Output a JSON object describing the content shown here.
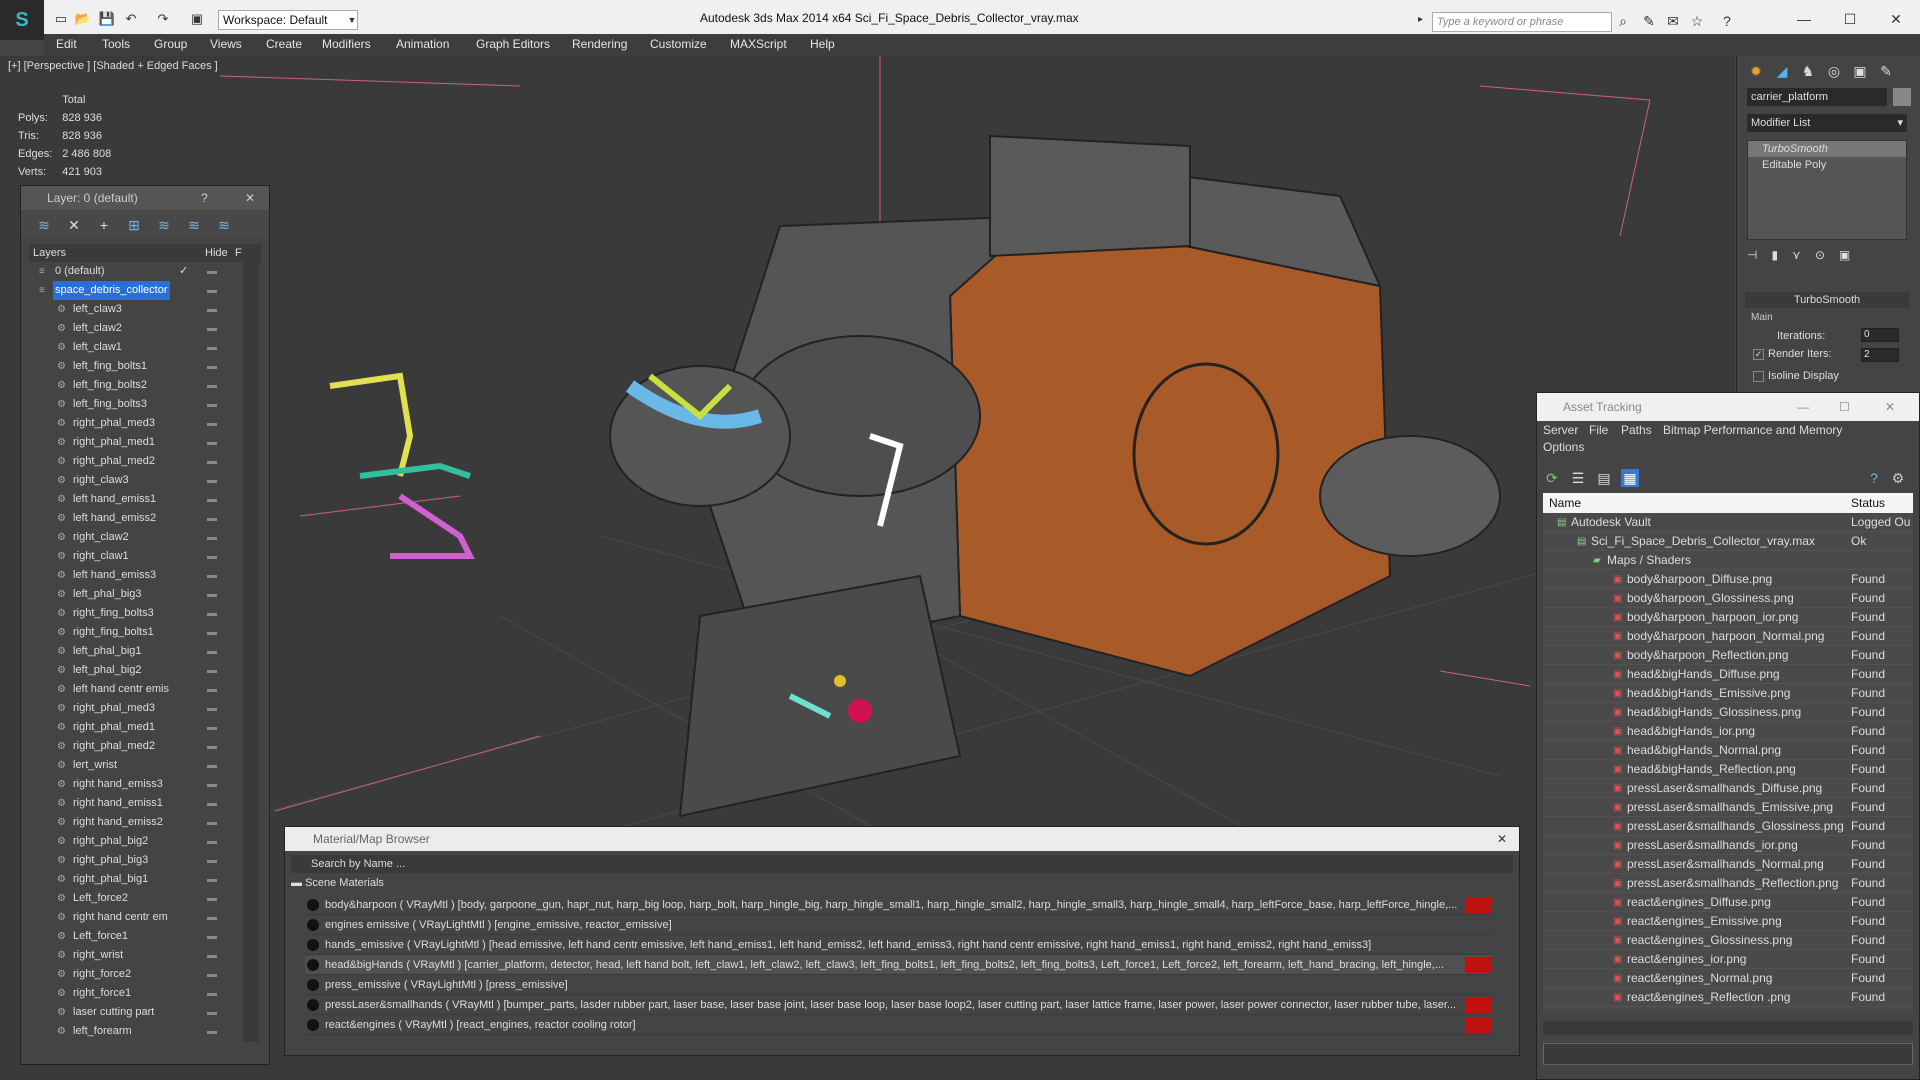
{
  "titlebar": {
    "workspace": "Workspace: Default",
    "title": "Autodesk 3ds Max  2014 x64     Sci_Fi_Space_Debris_Collector_vray.max",
    "search_placeholder": "Type a keyword or phrase"
  },
  "menu": [
    "Edit",
    "Tools",
    "Group",
    "Views",
    "Create",
    "Modifiers",
    "Animation",
    "Graph Editors",
    "Rendering",
    "Customize",
    "MAXScript",
    "Help"
  ],
  "viewport": {
    "label": "[+] [Perspective ] [Shaded + Edged Faces ]",
    "stats": {
      "header": "Total",
      "rows": [
        [
          "Polys:",
          "828 936"
        ],
        [
          "Tris:",
          "828 936"
        ],
        [
          "Edges:",
          "2 486 808"
        ],
        [
          "Verts:",
          "421 903"
        ]
      ]
    }
  },
  "layer_panel": {
    "title": "Layer: 0 (default)",
    "help": "?",
    "col_layers": "Layers",
    "col_hide": "Hide",
    "col_f": "F",
    "items": [
      "0 (default)",
      "space_debris_collector",
      "left_claw3",
      "left_claw2",
      "left_claw1",
      "left_fing_bolts1",
      "left_fing_bolts2",
      "left_fing_bolts3",
      "right_phal_med3",
      "right_phal_med1",
      "right_phal_med2",
      "right_claw3",
      "left hand_emiss1",
      "left hand_emiss2",
      "right_claw2",
      "right_claw1",
      "left hand_emiss3",
      "left_phal_big3",
      "right_fing_bolts3",
      "right_fing_bolts1",
      "left_phal_big1",
      "left_phal_big2",
      "left hand centr emis",
      "right_phal_med3",
      "right_phal_med1",
      "right_phal_med2",
      "lert_wrist",
      "right hand_emiss3",
      "right hand_emiss1",
      "right hand_emiss2",
      "right_phal_big2",
      "right_phal_big3",
      "right_phal_big1",
      "Left_force2",
      "right hand centr em",
      "Left_force1",
      "right_wrist",
      "right_force2",
      "right_force1",
      "laser cutting part",
      "left_forearm"
    ]
  },
  "asset_tracking": {
    "title": "Asset Tracking",
    "menu": [
      "Server",
      "File",
      "Paths",
      "Bitmap Performance and Memory",
      "Options"
    ],
    "col_name": "Name",
    "col_status": "Status",
    "rows": [
      {
        "name": "Autodesk Vault",
        "status": "Logged Ou",
        "indent": 1
      },
      {
        "name": "Sci_Fi_Space_Debris_Collector_vray.max",
        "status": "Ok",
        "indent": 2
      },
      {
        "name": "Maps / Shaders",
        "status": "",
        "indent": 3
      },
      {
        "name": "body&harpoon_Diffuse.png",
        "status": "Found",
        "indent": 4
      },
      {
        "name": "body&harpoon_Glossiness.png",
        "status": "Found",
        "indent": 4
      },
      {
        "name": "body&harpoon_harpoon_ior.png",
        "status": "Found",
        "indent": 4
      },
      {
        "name": "body&harpoon_harpoon_Normal.png",
        "status": "Found",
        "indent": 4
      },
      {
        "name": "body&harpoon_Reflection.png",
        "status": "Found",
        "indent": 4
      },
      {
        "name": "head&bigHands_Diffuse.png",
        "status": "Found",
        "indent": 4
      },
      {
        "name": "head&bigHands_Emissive.png",
        "status": "Found",
        "indent": 4
      },
      {
        "name": "head&bigHands_Glossiness.png",
        "status": "Found",
        "indent": 4
      },
      {
        "name": "head&bigHands_ior.png",
        "status": "Found",
        "indent": 4
      },
      {
        "name": "head&bigHands_Normal.png",
        "status": "Found",
        "indent": 4
      },
      {
        "name": "head&bigHands_Reflection.png",
        "status": "Found",
        "indent": 4
      },
      {
        "name": "pressLaser&smallhands_Diffuse.png",
        "status": "Found",
        "indent": 4
      },
      {
        "name": "pressLaser&smallhands_Emissive.png",
        "status": "Found",
        "indent": 4
      },
      {
        "name": "pressLaser&smallhands_Glossiness.png",
        "status": "Found",
        "indent": 4
      },
      {
        "name": "pressLaser&smallhands_ior.png",
        "status": "Found",
        "indent": 4
      },
      {
        "name": "pressLaser&smallhands_Normal.png",
        "status": "Found",
        "indent": 4
      },
      {
        "name": "pressLaser&smallhands_Reflection.png",
        "status": "Found",
        "indent": 4
      },
      {
        "name": "react&engines_Diffuse.png",
        "status": "Found",
        "indent": 4
      },
      {
        "name": "react&engines_Emissive.png",
        "status": "Found",
        "indent": 4
      },
      {
        "name": "react&engines_Glossiness.png",
        "status": "Found",
        "indent": 4
      },
      {
        "name": "react&engines_ior.png",
        "status": "Found",
        "indent": 4
      },
      {
        "name": "react&engines_Normal.png",
        "status": "Found",
        "indent": 4
      },
      {
        "name": "react&engines_Reflection .png",
        "status": "Found",
        "indent": 4
      }
    ]
  },
  "material_browser": {
    "title": "Material/Map Browser",
    "search": "Search by Name ...",
    "group": "Scene Materials",
    "rows": [
      {
        "text": "body&harpoon  ( VRayMtl ) [body, garpoone_gun, hapr_nut, harp_big loop, harp_bolt, harp_hingle_big, harp_hingle_small1, harp_hingle_small2, harp_hingle_small3, harp_hingle_small4, harp_leftForce_base, harp_leftForce_hingle,...",
        "red": true,
        "sel": false
      },
      {
        "text": "engines emissive  ( VRayLightMtl ) [engine_emissive, reactor_emissive]",
        "red": false,
        "sel": false
      },
      {
        "text": "hands_emissive  ( VRayLightMtl ) [head emissive, left hand centr emissive, left hand_emiss1, left hand_emiss2, left hand_emiss3, right hand centr emissive, right hand_emiss1, right hand_emiss2, right hand_emiss3]",
        "red": false,
        "sel": false
      },
      {
        "text": "head&bigHands  ( VRayMtl ) [carrier_platform, detector, head, left hand bolt, left_claw1, left_claw2, left_claw3, left_fing_bolts1, left_fing_bolts2, left_fing_bolts3, Left_force1, Left_force2, left_forearm, left_hand_bracing, left_hingle,...",
        "red": true,
        "sel": true
      },
      {
        "text": "press_emissive  ( VRayLightMtl ) [press_emissive]",
        "red": false,
        "sel": false
      },
      {
        "text": "pressLaser&smallhands  ( VRayMtl ) [bumper_parts, lasder rubber part, laser base, laser base joint, laser base loop, laser base loop2, laser cutting part, laser lattice frame, laser power, laser power connector, laser rubber tube, laser...",
        "red": true,
        "sel": false
      },
      {
        "text": "react&engines  ( VRayMtl ) [react_engines, reactor cooling rotor]",
        "red": true,
        "sel": false
      }
    ]
  },
  "command_panel": {
    "object_name": "carrier_platform",
    "modifier_list": "Modifier List",
    "stack": [
      "TurboSmooth",
      "Editable Poly"
    ],
    "rollout": "TurboSmooth",
    "group": "Main",
    "iterations_label": "Iterations:",
    "iterations": "0",
    "render_iters_label": "Render Iters:",
    "render_iters": "2",
    "isoline": "Isoline Display"
  }
}
